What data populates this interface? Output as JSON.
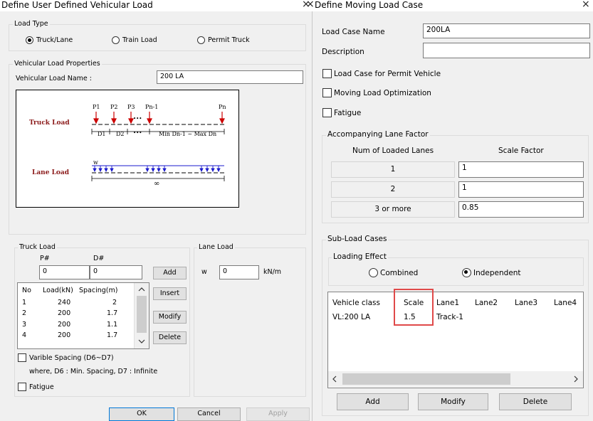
{
  "left_dialog": {
    "title": "Define User Defined Vehicular Load",
    "close": "×",
    "load_type": {
      "label": "Load Type",
      "options": [
        "Truck/Lane",
        "Train Load",
        "Permit Truck"
      ],
      "selected": "Truck/Lane"
    },
    "properties": {
      "label": "Vehicular Load Properties",
      "name_label": "Vehicular Load Name :",
      "name_value": "200 LA"
    },
    "diagram": {
      "truck_label": "Truck Load",
      "lane_label": "Lane Load",
      "p_labels": [
        "P1",
        "P2",
        "P3",
        "Pn-1",
        "Pn"
      ],
      "d_labels": [
        "D1",
        "D2",
        "Min Dn-1 ~ Max Dn"
      ],
      "dots": "•••",
      "w": "w",
      "infinity": "∞"
    },
    "truck_load": {
      "label": "Truck Load",
      "p_header": "P#",
      "d_header": "D#",
      "p_value": "0",
      "d_value": "0",
      "columns": [
        "No",
        "Load(kN)",
        "Spacing(m)"
      ],
      "rows": [
        [
          "1",
          "240",
          "2"
        ],
        [
          "2",
          "200",
          "1.7"
        ],
        [
          "3",
          "200",
          "1.1"
        ],
        [
          "4",
          "200",
          "1.7"
        ]
      ],
      "buttons": [
        "Add",
        "Insert",
        "Modify",
        "Delete"
      ],
      "variable_spacing": "Varible Spacing (D6~D7)",
      "where_text": "where, D6 : Min. Spacing, D7 : Infinite",
      "fatigue": "Fatigue"
    },
    "lane_load": {
      "label": "Lane Load",
      "w_label": "w",
      "value": "0",
      "unit": "kN/m"
    },
    "footer": {
      "ok": "OK",
      "cancel": "Cancel",
      "apply": "Apply"
    }
  },
  "right_dialog": {
    "title": "Define Moving Load Case",
    "close": "×",
    "case_name_label": "Load Case Name",
    "case_name_value": "200LA",
    "description_label": "Description",
    "description_value": "",
    "checks": [
      "Load Case for Permit Vehicle",
      "Moving Load Optimization",
      "Fatigue"
    ],
    "lane_factor": {
      "label": "Accompanying Lane Factor",
      "col1": "Num of Loaded Lanes",
      "col2": "Scale Factor",
      "rows": [
        {
          "lanes": "1",
          "factor": "1"
        },
        {
          "lanes": "2",
          "factor": "1"
        },
        {
          "lanes": "3 or more",
          "factor": "0.85"
        }
      ]
    },
    "sub_load": {
      "label": "Sub-Load Cases",
      "loading_effect_label": "Loading Effect",
      "options": [
        "Combined",
        "Independent"
      ],
      "selected": "Independent",
      "columns": [
        "Vehicle class",
        "Scale",
        "Lane1",
        "Lane2",
        "Lane3",
        "Lane4"
      ],
      "rows": [
        [
          "VL:200 LA",
          "1.5",
          "Track-1",
          "",
          "",
          ""
        ]
      ],
      "buttons": [
        "Add",
        "Modify",
        "Delete"
      ]
    }
  },
  "colors": {
    "arrow_red": "#cc0000",
    "lane_blue": "#1a1acc",
    "label_maroon": "#8b1a1a",
    "highlight_red": "#e04a4a"
  }
}
